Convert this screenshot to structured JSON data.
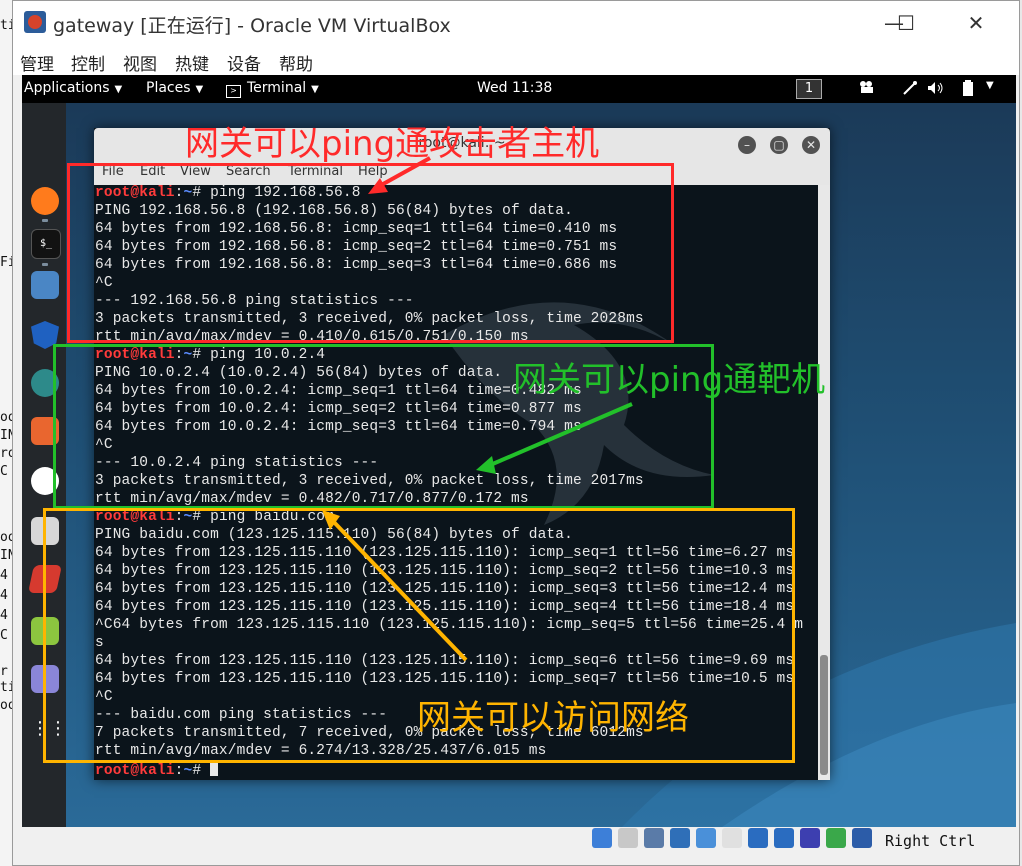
{
  "host": {
    "edge_fragments": [
      "tic",
      "Fil",
      "oo",
      "IN",
      "ro",
      "C",
      "",
      "oo",
      "IN",
      "4",
      "4",
      "4",
      "C",
      "",
      "r",
      "ti",
      "oo"
    ]
  },
  "vbox": {
    "title": "gateway [正在运行] - Oracle VM VirtualBox",
    "window_buttons": [
      "—",
      "☐",
      "✕"
    ],
    "menu": [
      "管理",
      "控制",
      "视图",
      "热键",
      "设备",
      "帮助"
    ],
    "status_text": "Right Ctrl"
  },
  "guest_topbar": {
    "applications": "Applications",
    "places": "Places",
    "terminal": "Terminal",
    "clock": "Wed 11:38",
    "workspace": "1"
  },
  "terminal": {
    "title": "root@kali: ~",
    "menu": [
      "File",
      "Edit",
      "View",
      "Search",
      "Terminal",
      "Help"
    ],
    "prompt_user": "root@kali",
    "prompt_path": "~",
    "lines": [
      {
        "cmd": "ping 192.168.56.8"
      },
      {
        "text": "PING 192.168.56.8 (192.168.56.8) 56(84) bytes of data."
      },
      {
        "text": "64 bytes from 192.168.56.8: icmp_seq=1 ttl=64 time=0.410 ms"
      },
      {
        "text": "64 bytes from 192.168.56.8: icmp_seq=2 ttl=64 time=0.751 ms"
      },
      {
        "text": "64 bytes from 192.168.56.8: icmp_seq=3 ttl=64 time=0.686 ms"
      },
      {
        "text": "^C"
      },
      {
        "text": "--- 192.168.56.8 ping statistics ---"
      },
      {
        "text": "3 packets transmitted, 3 received, 0% packet loss, time 2028ms"
      },
      {
        "text": "rtt min/avg/max/mdev = 0.410/0.615/0.751/0.150 ms"
      },
      {
        "cmd": "ping 10.0.2.4"
      },
      {
        "text": "PING 10.0.2.4 (10.0.2.4) 56(84) bytes of data."
      },
      {
        "text": "64 bytes from 10.0.2.4: icmp_seq=1 ttl=64 time=0.482 ms"
      },
      {
        "text": "64 bytes from 10.0.2.4: icmp_seq=2 ttl=64 time=0.877 ms"
      },
      {
        "text": "64 bytes from 10.0.2.4: icmp_seq=3 ttl=64 time=0.794 ms"
      },
      {
        "text": "^C"
      },
      {
        "text": "--- 10.0.2.4 ping statistics ---"
      },
      {
        "text": "3 packets transmitted, 3 received, 0% packet loss, time 2017ms"
      },
      {
        "text": "rtt min/avg/max/mdev = 0.482/0.717/0.877/0.172 ms"
      },
      {
        "cmd": "ping baidu.com"
      },
      {
        "text": "PING baidu.com (123.125.115.110) 56(84) bytes of data."
      },
      {
        "text": "64 bytes from 123.125.115.110 (123.125.115.110): icmp_seq=1 ttl=56 time=6.27 ms"
      },
      {
        "text": "64 bytes from 123.125.115.110 (123.125.115.110): icmp_seq=2 ttl=56 time=10.3 ms"
      },
      {
        "text": "64 bytes from 123.125.115.110 (123.125.115.110): icmp_seq=3 ttl=56 time=12.4 ms"
      },
      {
        "text": "64 bytes from 123.125.115.110 (123.125.115.110): icmp_seq=4 ttl=56 time=18.4 ms"
      },
      {
        "text": "^C64 bytes from 123.125.115.110 (123.125.115.110): icmp_seq=5 ttl=56 time=25.4 m"
      },
      {
        "text": "s"
      },
      {
        "text": "64 bytes from 123.125.115.110 (123.125.115.110): icmp_seq=6 ttl=56 time=9.69 ms"
      },
      {
        "text": "64 bytes from 123.125.115.110 (123.125.115.110): icmp_seq=7 ttl=56 time=10.5 ms"
      },
      {
        "text": "^C"
      },
      {
        "text": "--- baidu.com ping statistics ---"
      },
      {
        "text": "7 packets transmitted, 7 received, 0% packet loss, time 6012ms"
      },
      {
        "text": "rtt min/avg/max/mdev = 6.274/13.328/25.437/6.015 ms"
      },
      {
        "cmd": "",
        "cursor": true
      }
    ]
  },
  "annotations": {
    "attacker": {
      "text": "网关可以ping通攻击者主机",
      "color": "#ff2a2a"
    },
    "target": {
      "text": "网关可以ping通靶机",
      "color": "#22c02a"
    },
    "internet": {
      "text": "网关可以访问网络",
      "color": "#ffb400"
    }
  },
  "colors": {
    "prompt": "#ff3b3b",
    "path": "#5b8cff",
    "terminal_bg": "#0b141b",
    "topbar_bg": "#000000"
  },
  "dock_icons": [
    "firefox-icon",
    "terminal-icon",
    "files-icon",
    "metasploit-icon",
    "armitage-icon",
    "burpsuite-icon",
    "maltego-icon",
    "beef-icon",
    "faraday-icon",
    "leafpad-icon",
    "text-editor-icon",
    "show-apps-icon"
  ],
  "status_icons": [
    "disk-icon",
    "optical-drive-icon",
    "usb-icon",
    "network-icon",
    "pencil-icon",
    "shared-folder-icon",
    "display-icon",
    "video-capture-icon",
    "cpu-icon",
    "mouse-integration-icon",
    "keyboard-capture-icon"
  ]
}
